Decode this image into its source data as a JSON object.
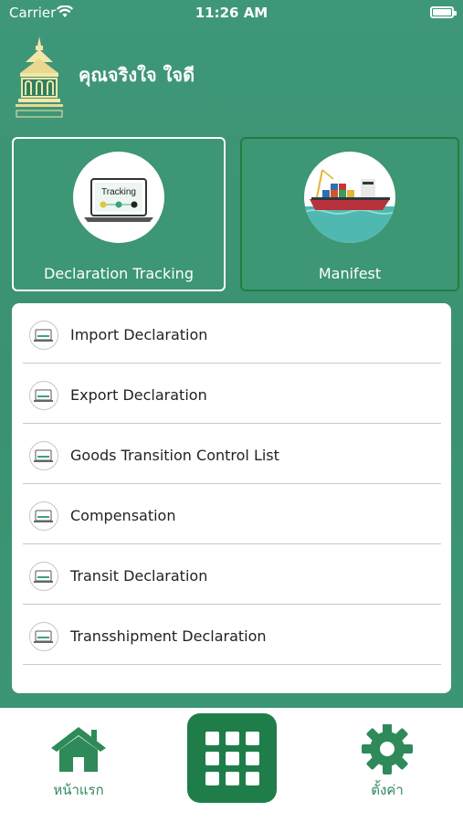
{
  "status_bar": {
    "carrier": "Carrier",
    "time": "11:26 AM"
  },
  "header": {
    "user_name": "คุณจริงใจ ใจดี"
  },
  "cards": {
    "tracking": {
      "label": "Declaration Tracking",
      "badge_text": "Tracking"
    },
    "manifest": {
      "label": "Manifest"
    }
  },
  "menu": {
    "items": [
      {
        "label": "Import Declaration"
      },
      {
        "label": "Export Declaration"
      },
      {
        "label": "Goods Transition Control List"
      },
      {
        "label": "Compensation"
      },
      {
        "label": "Transit Declaration"
      },
      {
        "label": "Transshipment Declaration"
      }
    ]
  },
  "tabbar": {
    "home_label": "หน้าแรก",
    "settings_label": "ตั้งค่า"
  },
  "colors": {
    "background_green": "#3c9471",
    "accent_green": "#1f7d49",
    "tab_label_green": "#2e8a58"
  }
}
